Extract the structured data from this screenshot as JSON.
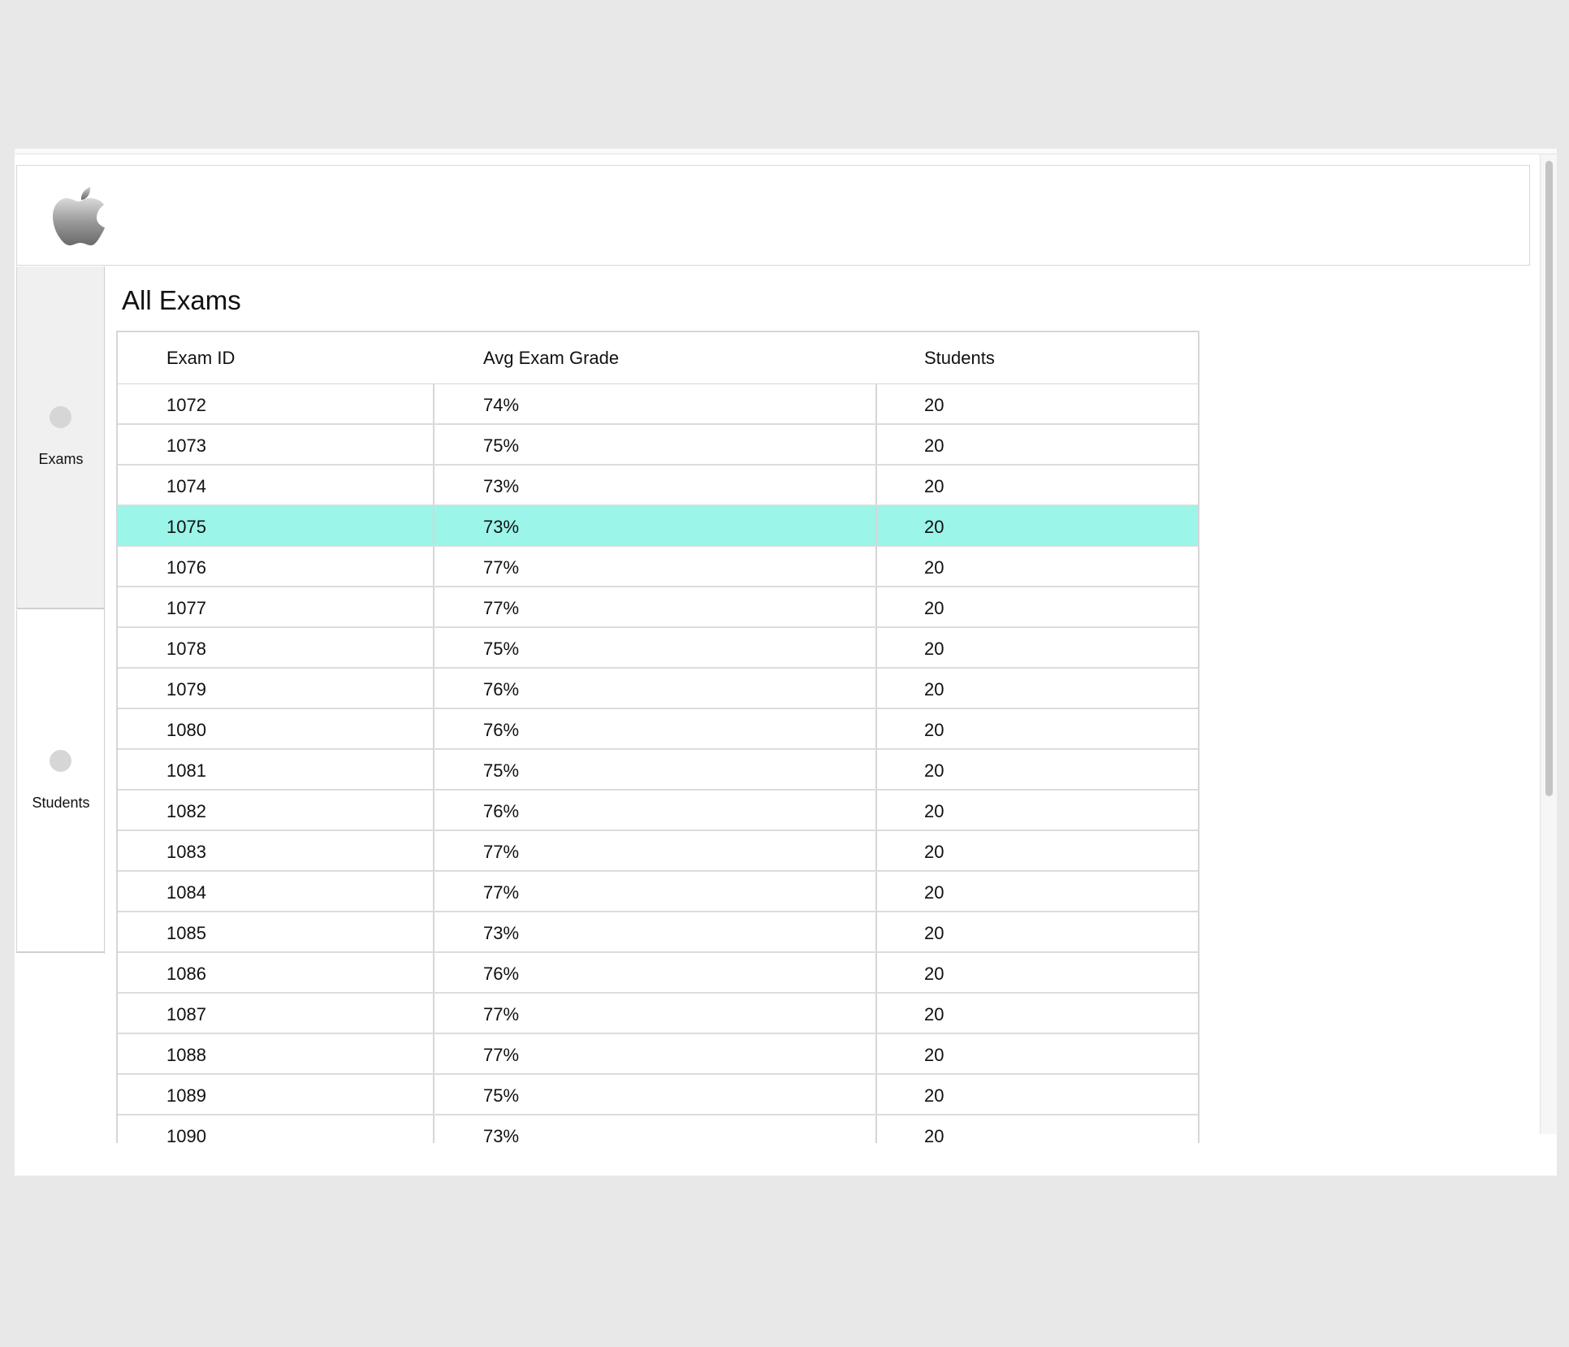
{
  "sidebar": {
    "items": [
      {
        "label": "Exams",
        "active": true
      },
      {
        "label": "Students",
        "active": false
      }
    ]
  },
  "page": {
    "title": "All Exams"
  },
  "table": {
    "columns": [
      "Exam ID",
      "Avg Exam Grade",
      "Students"
    ],
    "selected_exam_id": "1075",
    "rows": [
      {
        "id": "1072",
        "avg": "74%",
        "students": "20"
      },
      {
        "id": "1073",
        "avg": "75%",
        "students": "20"
      },
      {
        "id": "1074",
        "avg": "73%",
        "students": "20"
      },
      {
        "id": "1075",
        "avg": "73%",
        "students": "20"
      },
      {
        "id": "1076",
        "avg": "77%",
        "students": "20"
      },
      {
        "id": "1077",
        "avg": "77%",
        "students": "20"
      },
      {
        "id": "1078",
        "avg": "75%",
        "students": "20"
      },
      {
        "id": "1079",
        "avg": "76%",
        "students": "20"
      },
      {
        "id": "1080",
        "avg": "76%",
        "students": "20"
      },
      {
        "id": "1081",
        "avg": "75%",
        "students": "20"
      },
      {
        "id": "1082",
        "avg": "76%",
        "students": "20"
      },
      {
        "id": "1083",
        "avg": "77%",
        "students": "20"
      },
      {
        "id": "1084",
        "avg": "77%",
        "students": "20"
      },
      {
        "id": "1085",
        "avg": "73%",
        "students": "20"
      },
      {
        "id": "1086",
        "avg": "76%",
        "students": "20"
      },
      {
        "id": "1087",
        "avg": "77%",
        "students": "20"
      },
      {
        "id": "1088",
        "avg": "77%",
        "students": "20"
      },
      {
        "id": "1089",
        "avg": "75%",
        "students": "20"
      },
      {
        "id": "1090",
        "avg": "73%",
        "students": "20"
      }
    ]
  },
  "colors": {
    "selected_row": "#9bf5e8",
    "active_nav": "#f0f0f0"
  },
  "icons": {
    "logo": "apple-logo-icon",
    "nav_dot": "circle-icon"
  }
}
